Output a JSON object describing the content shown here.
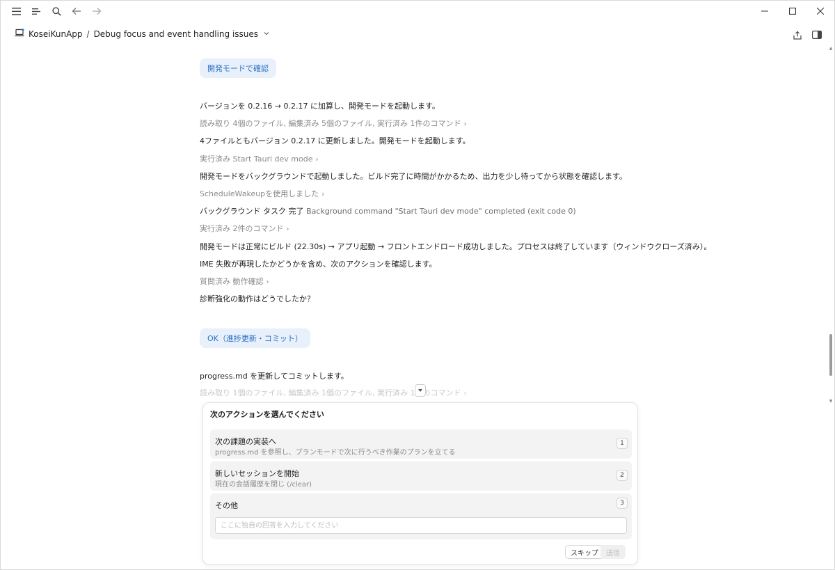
{
  "header": {
    "project": "KoseiKunApp",
    "separator": "/",
    "session_title": "Debug focus and event handling issues"
  },
  "chips": {
    "dev_mode_check": "開発モードで確認",
    "ok_commit": "OK（進捗更新・コミット）"
  },
  "messages": [
    "バージョンを 0.2.16 → 0.2.17 に加算し、開発モードを起動します。",
    "読み取り 4個のファイル, 編集済み 5個のファイル, 実行済み 1件のコマンド",
    "4ファイルともバージョン 0.2.17 に更新しました。開発モードを起動します。",
    "実行済み Start Tauri dev mode",
    "開発モードをバックグラウンドで起動しました。ビルド完了に時間がかかるため、出力を少し待ってから状態を確認します。",
    "ScheduleWakeupを使用しました",
    "バックグラウンド タスク 完了",
    "Background command \"Start Tauri dev mode\" completed (exit code 0)",
    "実行済み 2件のコマンド",
    "開発モードは正常にビルド (22.30s) → アプリ起動 → フロントエンドロード成功しました。プロセスは終了しています（ウィンドウクローズ済み）。",
    "IME 失敗が再現したかどうかを含め、次のアクションを確認します。",
    "質問済み 動作確認",
    "診断強化の動作はどうでしたか？",
    "progress.md を更新してコミットします。",
    "読み取り 1個のファイル, 編集済み 1個のファイル, 実行済み 1件のコマンド"
  ],
  "arrow": "›",
  "question": {
    "title": "次のアクションを選んでください",
    "options": [
      {
        "label": "次の課題の実装へ",
        "desc": "progress.md を参照し、プランモードで次に行うべき作業のプランを立てる",
        "num": "1"
      },
      {
        "label": "新しいセッションを開始",
        "desc": "現在の会話履歴を閉じ (/clear)",
        "num": "2"
      },
      {
        "label": "その他",
        "desc": "",
        "num": "3"
      }
    ],
    "other_placeholder": "ここに独自の回答を入力してください",
    "skip_label": "スキップ",
    "send_label": "送信"
  },
  "icons": {
    "menu": "hamburger-menu-icon",
    "outline": "outline-list-icon",
    "search": "search-icon",
    "back": "arrow-left-icon",
    "forward": "arrow-right-icon",
    "share": "share-icon",
    "sidebar": "sidebar-toggle-icon"
  },
  "colors": {
    "accent": "#2a6fc4",
    "chip_bg": "#e7f0fb",
    "meta_text": "#8a8a8a"
  }
}
